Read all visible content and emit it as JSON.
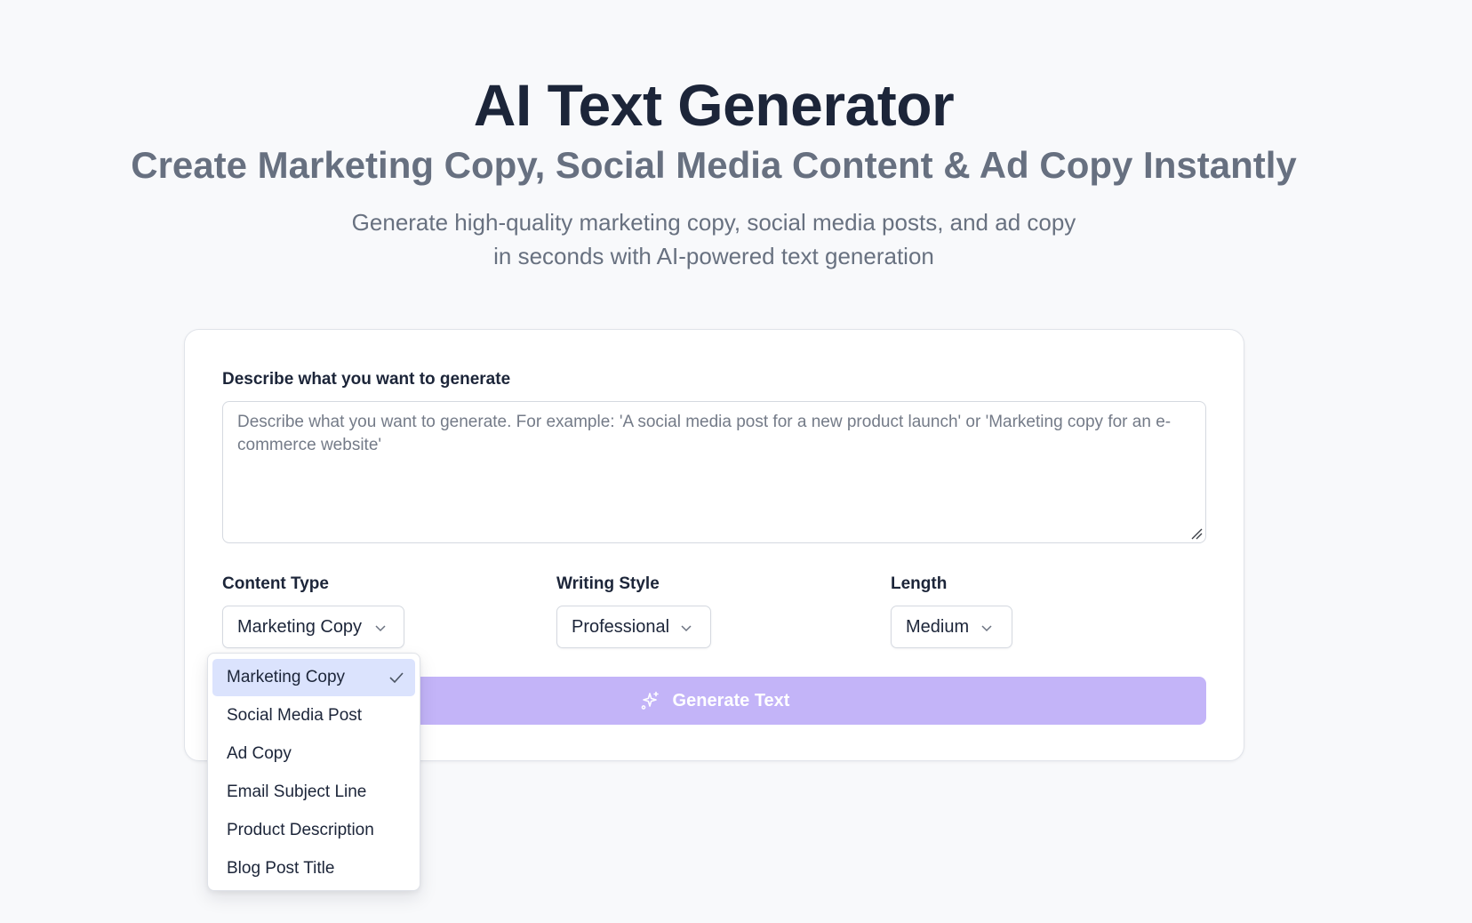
{
  "header": {
    "title": "AI Text Generator",
    "subtitle": "Create Marketing Copy, Social Media Content & Ad Copy Instantly",
    "description_line1": "Generate high-quality marketing copy, social media posts, and ad copy",
    "description_line2": "in seconds with AI-powered text generation"
  },
  "form": {
    "prompt_label": "Describe what you want to generate",
    "prompt_placeholder": "Describe what you want to generate. For example: 'A social media post for a new product launch' or 'Marketing copy for an e-commerce website'",
    "prompt_value": "",
    "content_type": {
      "label": "Content Type",
      "selected": "Marketing Copy",
      "options": [
        "Marketing Copy",
        "Social Media Post",
        "Ad Copy",
        "Email Subject Line",
        "Product Description",
        "Blog Post Title"
      ],
      "open": true
    },
    "writing_style": {
      "label": "Writing Style",
      "selected": "Professional"
    },
    "length": {
      "label": "Length",
      "selected": "Medium"
    },
    "generate_button": {
      "label": "Generate Text",
      "icon": "sparkles-icon",
      "disabled": true
    }
  },
  "colors": {
    "background": "#f8f9fb",
    "title": "#1c2539",
    "muted_text": "#687180",
    "button_disabled": "#c3b4f8",
    "option_selected": "#dbe3fd"
  }
}
